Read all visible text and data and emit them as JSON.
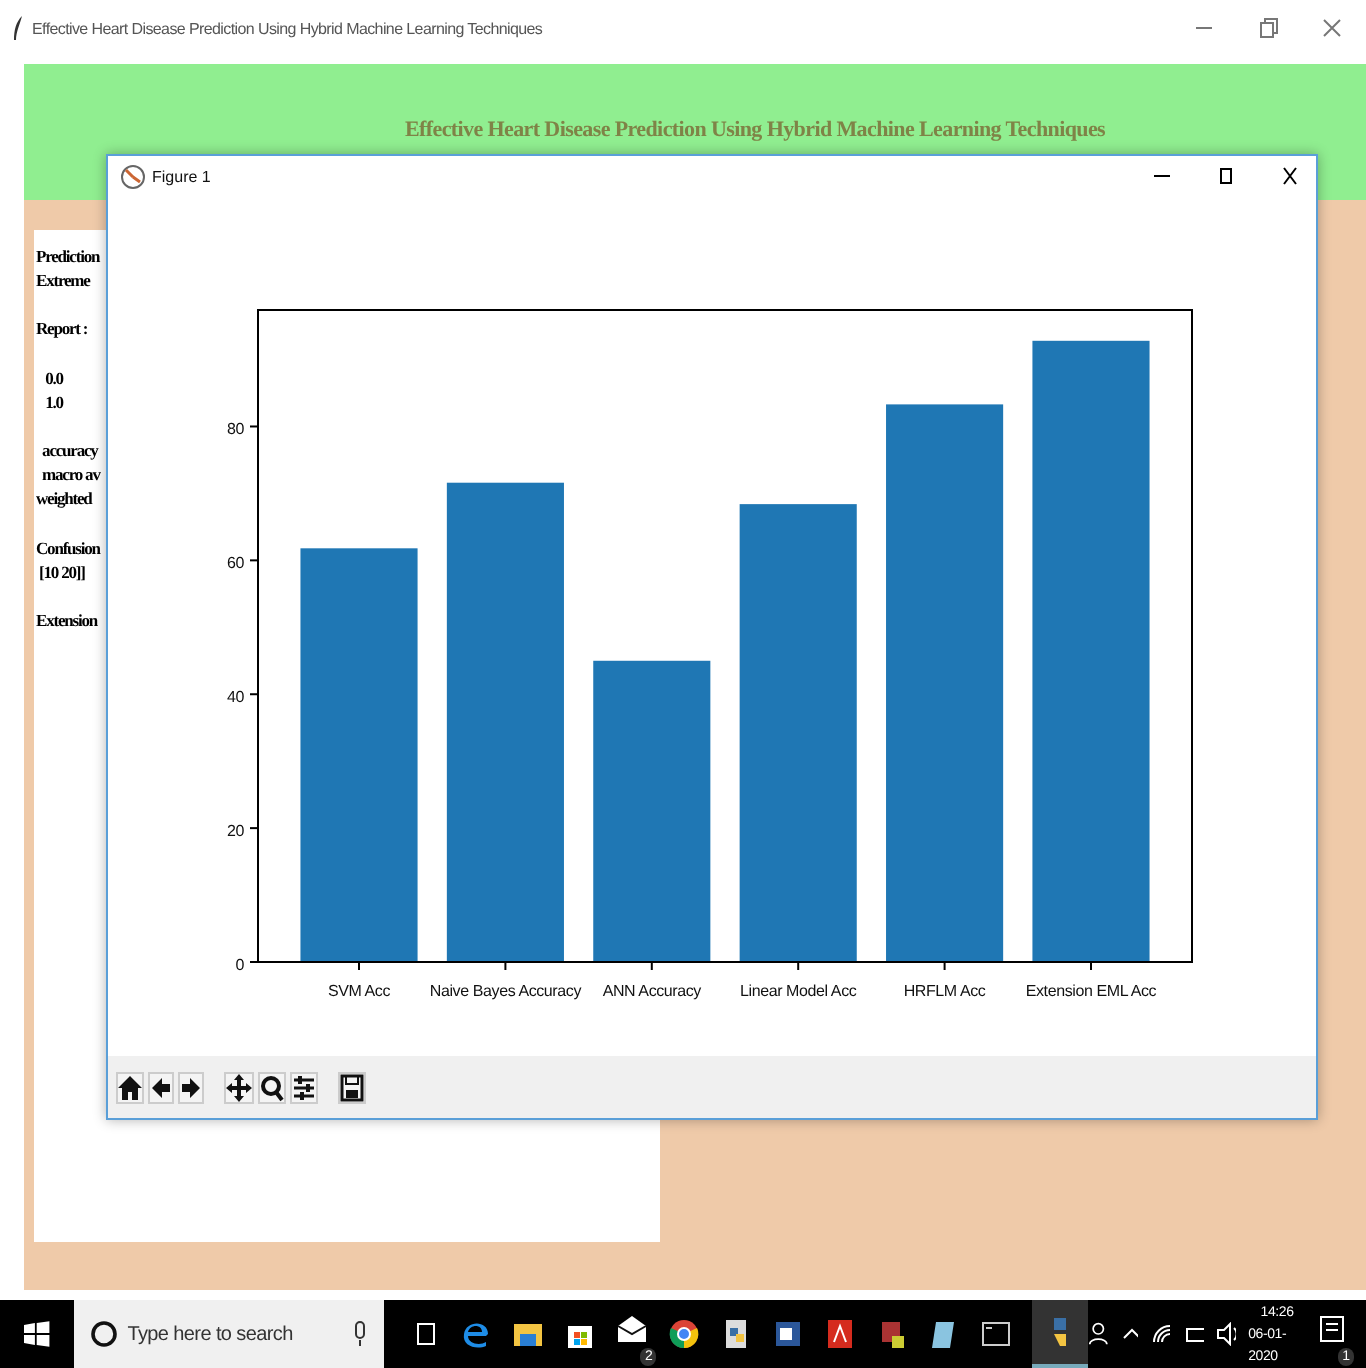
{
  "window": {
    "title": "Effective Heart Disease Prediction Using Hybrid Machine Learning Techniques"
  },
  "header": {
    "title": "Effective Heart Disease Prediction Using Hybrid Machine Learning Techniques"
  },
  "output_blocks": [
    [
      "Prediction",
      "Extreme"
    ],
    [
      "Report :"
    ],
    [
      "   0.0",
      "   1.0"
    ],
    [
      "  accuracy",
      "  macro av",
      "weighted"
    ],
    [
      "Confusion",
      " [10 20]]"
    ],
    [
      "Extension"
    ]
  ],
  "figure": {
    "title": "Figure 1",
    "chart_data": {
      "type": "bar",
      "categories": [
        "SVM Acc",
        "Naive Bayes Accuracy",
        "ANN Accuracy",
        "Linear Model Acc",
        "HRFLM Acc",
        "Extension EML Acc"
      ],
      "series": [
        {
          "color": "#1f77b4",
          "values": [
            61.8,
            71.6,
            45.0,
            68.4,
            83.3,
            92.8
          ]
        }
      ],
      "ylim": [
        0,
        97.4
      ],
      "yticks": [
        0,
        20,
        40,
        60,
        80
      ]
    }
  },
  "taskbar": {
    "search_placeholder": "Type here to search",
    "mail_badge": "2",
    "time": "14:26",
    "date": "06-01-2020",
    "notification_badge": "1"
  }
}
